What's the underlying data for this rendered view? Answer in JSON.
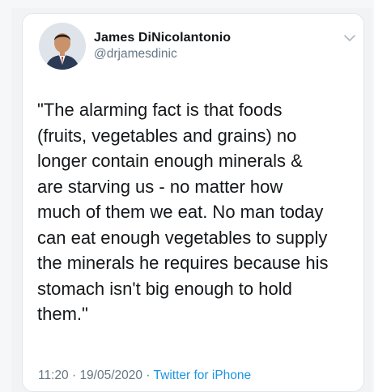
{
  "tweet": {
    "author_name": "James DiNicolantonio",
    "author_handle": "@drjamesdinic",
    "body": "\"The alarming fact is that foods\n(fruits, vegetables and grains) no\nlonger contain enough minerals &\nare starving us - no matter how\nmuch of them we eat. No man today\ncan eat enough vegetables to supply\nthe minerals he requires because his\nstomach isn't big enough to hold\nthem.\"",
    "time": "11:20",
    "separator": "·",
    "date": "19/05/2020",
    "source": "Twitter for iPhone"
  },
  "icons": {
    "avatar": "profile-photo",
    "menu": "chevron-down-icon"
  },
  "colors": {
    "text": "#14171a",
    "secondary": "#657786",
    "link": "#1b95e0"
  }
}
